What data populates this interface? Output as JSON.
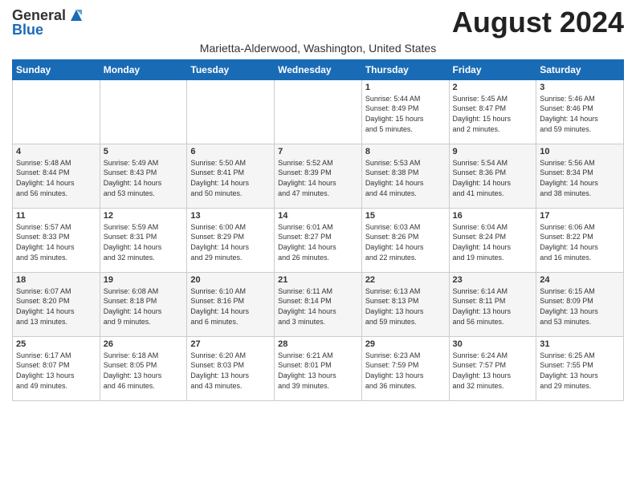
{
  "logo": {
    "general": "General",
    "blue": "Blue"
  },
  "title": "August 2024",
  "subtitle": "Marietta-Alderwood, Washington, United States",
  "days_of_week": [
    "Sunday",
    "Monday",
    "Tuesday",
    "Wednesday",
    "Thursday",
    "Friday",
    "Saturday"
  ],
  "weeks": [
    [
      {
        "day": "",
        "info": ""
      },
      {
        "day": "",
        "info": ""
      },
      {
        "day": "",
        "info": ""
      },
      {
        "day": "",
        "info": ""
      },
      {
        "day": "1",
        "info": "Sunrise: 5:44 AM\nSunset: 8:49 PM\nDaylight: 15 hours\nand 5 minutes."
      },
      {
        "day": "2",
        "info": "Sunrise: 5:45 AM\nSunset: 8:47 PM\nDaylight: 15 hours\nand 2 minutes."
      },
      {
        "day": "3",
        "info": "Sunrise: 5:46 AM\nSunset: 8:46 PM\nDaylight: 14 hours\nand 59 minutes."
      }
    ],
    [
      {
        "day": "4",
        "info": "Sunrise: 5:48 AM\nSunset: 8:44 PM\nDaylight: 14 hours\nand 56 minutes."
      },
      {
        "day": "5",
        "info": "Sunrise: 5:49 AM\nSunset: 8:43 PM\nDaylight: 14 hours\nand 53 minutes."
      },
      {
        "day": "6",
        "info": "Sunrise: 5:50 AM\nSunset: 8:41 PM\nDaylight: 14 hours\nand 50 minutes."
      },
      {
        "day": "7",
        "info": "Sunrise: 5:52 AM\nSunset: 8:39 PM\nDaylight: 14 hours\nand 47 minutes."
      },
      {
        "day": "8",
        "info": "Sunrise: 5:53 AM\nSunset: 8:38 PM\nDaylight: 14 hours\nand 44 minutes."
      },
      {
        "day": "9",
        "info": "Sunrise: 5:54 AM\nSunset: 8:36 PM\nDaylight: 14 hours\nand 41 minutes."
      },
      {
        "day": "10",
        "info": "Sunrise: 5:56 AM\nSunset: 8:34 PM\nDaylight: 14 hours\nand 38 minutes."
      }
    ],
    [
      {
        "day": "11",
        "info": "Sunrise: 5:57 AM\nSunset: 8:33 PM\nDaylight: 14 hours\nand 35 minutes."
      },
      {
        "day": "12",
        "info": "Sunrise: 5:59 AM\nSunset: 8:31 PM\nDaylight: 14 hours\nand 32 minutes."
      },
      {
        "day": "13",
        "info": "Sunrise: 6:00 AM\nSunset: 8:29 PM\nDaylight: 14 hours\nand 29 minutes."
      },
      {
        "day": "14",
        "info": "Sunrise: 6:01 AM\nSunset: 8:27 PM\nDaylight: 14 hours\nand 26 minutes."
      },
      {
        "day": "15",
        "info": "Sunrise: 6:03 AM\nSunset: 8:26 PM\nDaylight: 14 hours\nand 22 minutes."
      },
      {
        "day": "16",
        "info": "Sunrise: 6:04 AM\nSunset: 8:24 PM\nDaylight: 14 hours\nand 19 minutes."
      },
      {
        "day": "17",
        "info": "Sunrise: 6:06 AM\nSunset: 8:22 PM\nDaylight: 14 hours\nand 16 minutes."
      }
    ],
    [
      {
        "day": "18",
        "info": "Sunrise: 6:07 AM\nSunset: 8:20 PM\nDaylight: 14 hours\nand 13 minutes."
      },
      {
        "day": "19",
        "info": "Sunrise: 6:08 AM\nSunset: 8:18 PM\nDaylight: 14 hours\nand 9 minutes."
      },
      {
        "day": "20",
        "info": "Sunrise: 6:10 AM\nSunset: 8:16 PM\nDaylight: 14 hours\nand 6 minutes."
      },
      {
        "day": "21",
        "info": "Sunrise: 6:11 AM\nSunset: 8:14 PM\nDaylight: 14 hours\nand 3 minutes."
      },
      {
        "day": "22",
        "info": "Sunrise: 6:13 AM\nSunset: 8:13 PM\nDaylight: 13 hours\nand 59 minutes."
      },
      {
        "day": "23",
        "info": "Sunrise: 6:14 AM\nSunset: 8:11 PM\nDaylight: 13 hours\nand 56 minutes."
      },
      {
        "day": "24",
        "info": "Sunrise: 6:15 AM\nSunset: 8:09 PM\nDaylight: 13 hours\nand 53 minutes."
      }
    ],
    [
      {
        "day": "25",
        "info": "Sunrise: 6:17 AM\nSunset: 8:07 PM\nDaylight: 13 hours\nand 49 minutes."
      },
      {
        "day": "26",
        "info": "Sunrise: 6:18 AM\nSunset: 8:05 PM\nDaylight: 13 hours\nand 46 minutes."
      },
      {
        "day": "27",
        "info": "Sunrise: 6:20 AM\nSunset: 8:03 PM\nDaylight: 13 hours\nand 43 minutes."
      },
      {
        "day": "28",
        "info": "Sunrise: 6:21 AM\nSunset: 8:01 PM\nDaylight: 13 hours\nand 39 minutes."
      },
      {
        "day": "29",
        "info": "Sunrise: 6:23 AM\nSunset: 7:59 PM\nDaylight: 13 hours\nand 36 minutes."
      },
      {
        "day": "30",
        "info": "Sunrise: 6:24 AM\nSunset: 7:57 PM\nDaylight: 13 hours\nand 32 minutes."
      },
      {
        "day": "31",
        "info": "Sunrise: 6:25 AM\nSunset: 7:55 PM\nDaylight: 13 hours\nand 29 minutes."
      }
    ]
  ]
}
